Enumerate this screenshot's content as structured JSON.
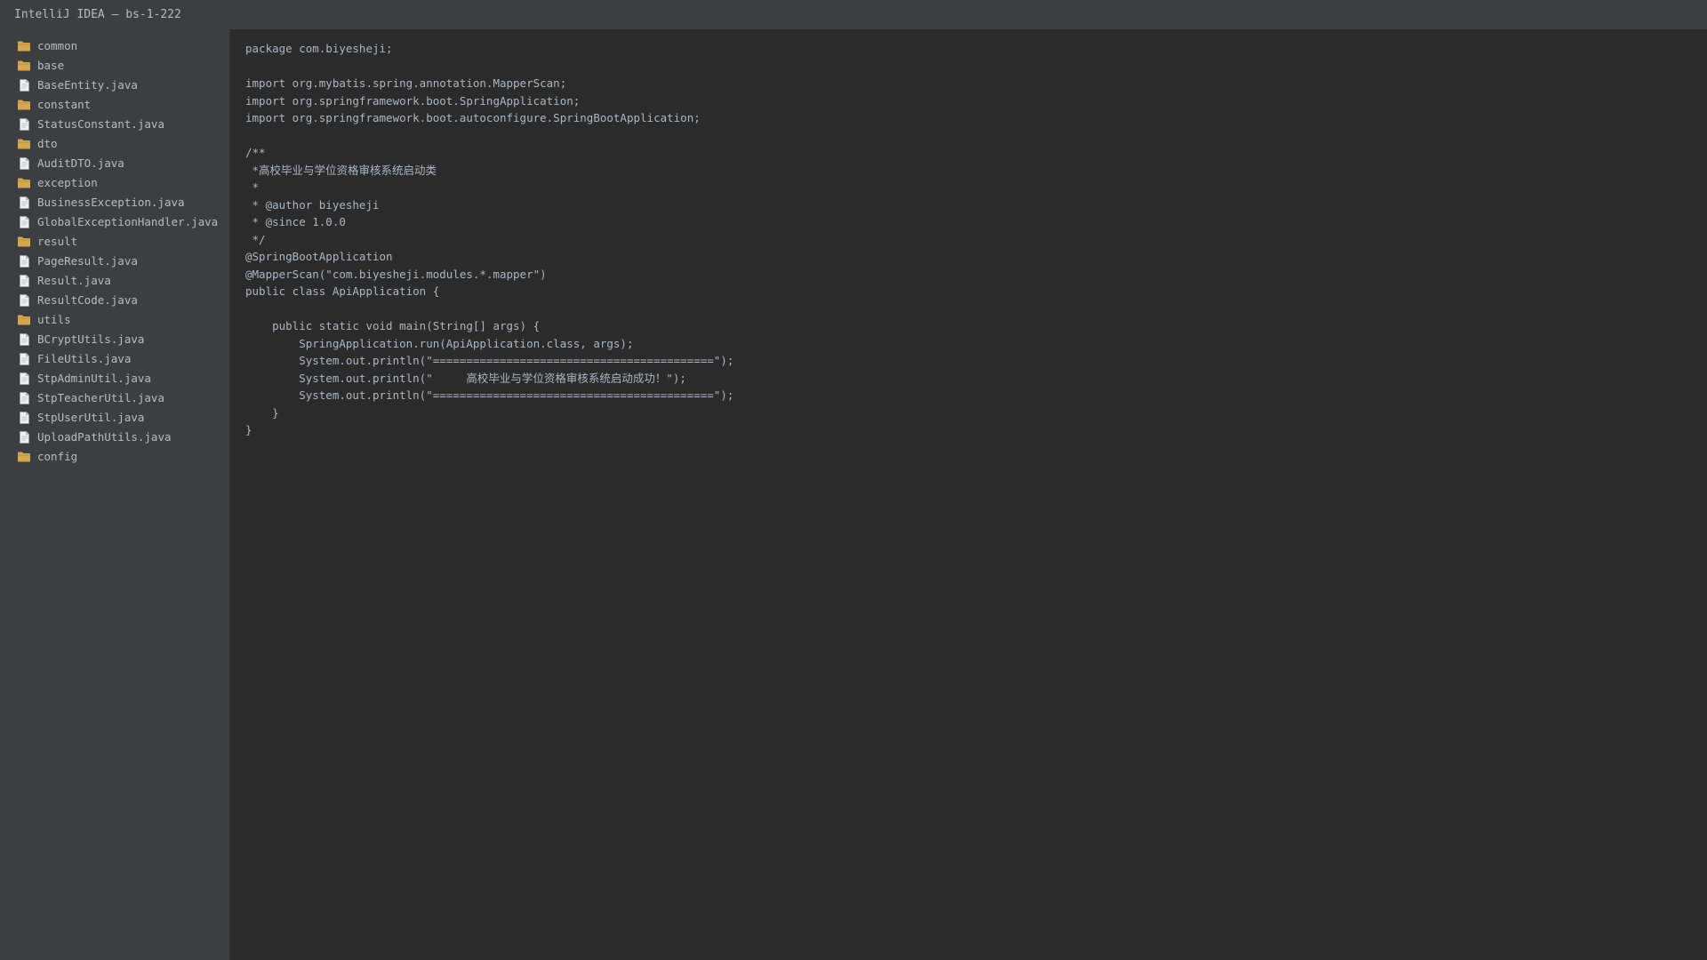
{
  "window": {
    "title": "IntelliJ IDEA — bs-1-222"
  },
  "colors": {
    "titlebar_bg": "#3c3f41",
    "sidebar_bg": "#3c3f41",
    "editor_bg": "#2b2b2b",
    "folder_icon": "#d6a84e",
    "file_icon": "#b8c2cc"
  },
  "project_tree": {
    "items": [
      {
        "label": "common",
        "type": "folder",
        "icon": "folder-icon"
      },
      {
        "label": "base",
        "type": "folder",
        "icon": "folder-icon"
      },
      {
        "label": "BaseEntity.java",
        "type": "file",
        "icon": "file-icon"
      },
      {
        "label": "constant",
        "type": "folder",
        "icon": "folder-icon"
      },
      {
        "label": "StatusConstant.java",
        "type": "file",
        "icon": "file-icon"
      },
      {
        "label": "dto",
        "type": "folder",
        "icon": "folder-icon"
      },
      {
        "label": "AuditDTO.java",
        "type": "file",
        "icon": "file-icon"
      },
      {
        "label": "exception",
        "type": "folder",
        "icon": "folder-icon"
      },
      {
        "label": "BusinessException.java",
        "type": "file",
        "icon": "file-icon"
      },
      {
        "label": "GlobalExceptionHandler.java",
        "type": "file",
        "icon": "file-icon"
      },
      {
        "label": "result",
        "type": "folder",
        "icon": "folder-icon"
      },
      {
        "label": "PageResult.java",
        "type": "file",
        "icon": "file-icon"
      },
      {
        "label": "Result.java",
        "type": "file",
        "icon": "file-icon"
      },
      {
        "label": "ResultCode.java",
        "type": "file",
        "icon": "file-icon"
      },
      {
        "label": "utils",
        "type": "folder",
        "icon": "folder-icon"
      },
      {
        "label": "BCryptUtils.java",
        "type": "file",
        "icon": "file-icon"
      },
      {
        "label": "FileUtils.java",
        "type": "file",
        "icon": "file-icon"
      },
      {
        "label": "StpAdminUtil.java",
        "type": "file",
        "icon": "file-icon"
      },
      {
        "label": "StpTeacherUtil.java",
        "type": "file",
        "icon": "file-icon"
      },
      {
        "label": "StpUserUtil.java",
        "type": "file",
        "icon": "file-icon"
      },
      {
        "label": "UploadPathUtils.java",
        "type": "file",
        "icon": "file-icon"
      },
      {
        "label": "config",
        "type": "folder",
        "icon": "folder-icon"
      }
    ]
  },
  "editor": {
    "lines": [
      "package com.biyesheji;",
      "",
      "import org.mybatis.spring.annotation.MapperScan;",
      "import org.springframework.boot.SpringApplication;",
      "import org.springframework.boot.autoconfigure.SpringBootApplication;",
      "",
      "/**",
      " *高校毕业与学位资格审核系统启动类",
      " *",
      " * @author biyesheji",
      " * @since 1.0.0",
      " */",
      "@SpringBootApplication",
      "@MapperScan(\"com.biyesheji.modules.*.mapper\")",
      "public class ApiApplication {",
      "",
      "    public static void main(String[] args) {",
      "        SpringApplication.run(ApiApplication.class, args);",
      "        System.out.println(\"==========================================\");",
      "        System.out.println(\"     高校毕业与学位资格审核系统启动成功！\");",
      "        System.out.println(\"==========================================\");",
      "    }",
      "}"
    ]
  }
}
